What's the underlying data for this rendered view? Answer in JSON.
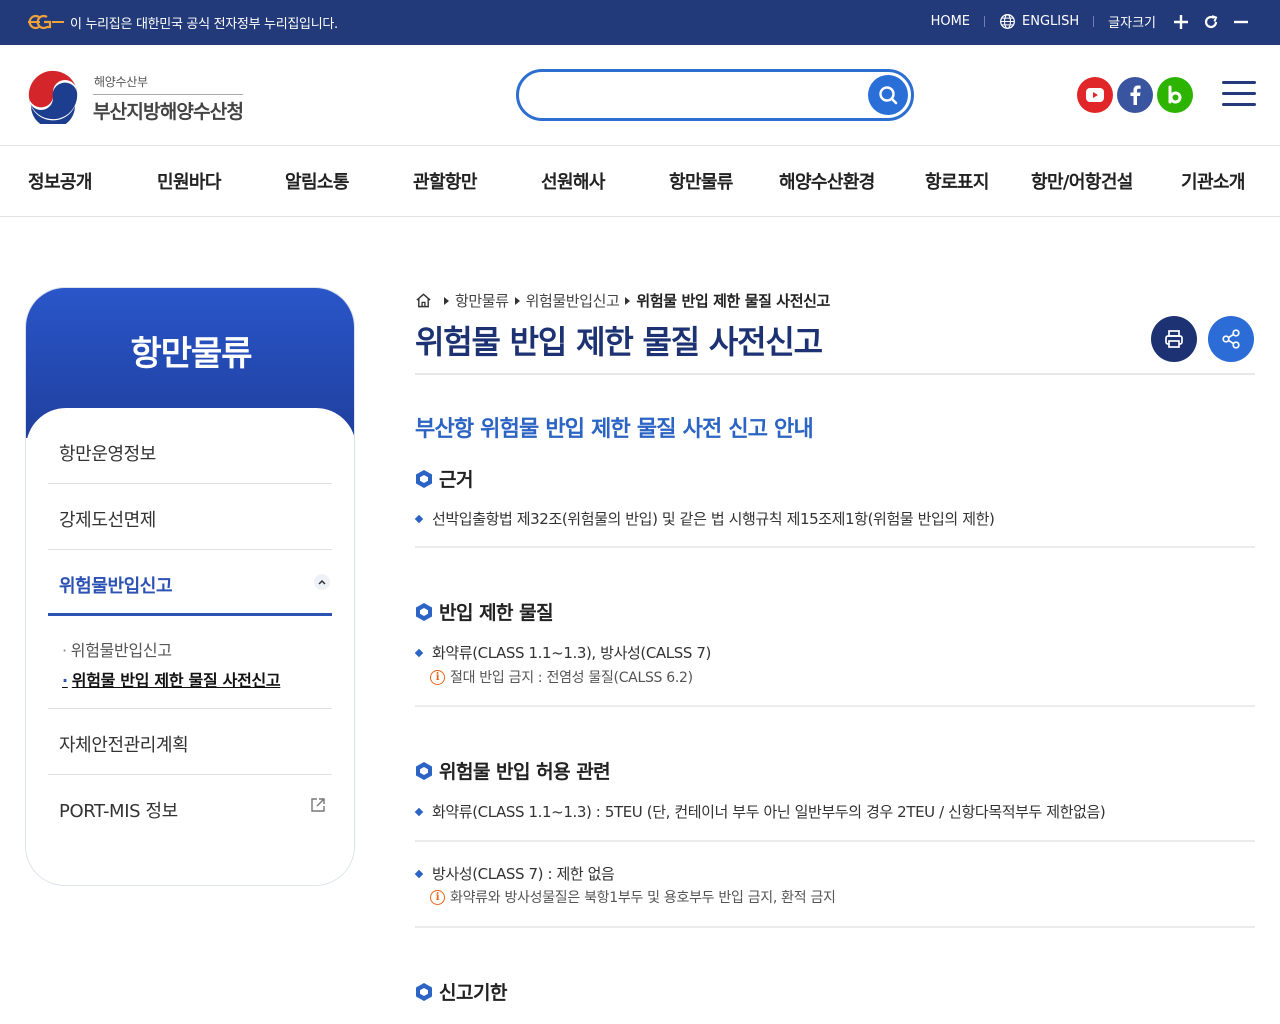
{
  "gov_bar": {
    "text": "이 누리집은 대한민국 공식 전자정부 누리집입니다.",
    "home": "HOME",
    "english": "ENGLISH",
    "font_size": "글자크기"
  },
  "header": {
    "org_sub": "해양수산부",
    "org_main": "부산지방해양수산청",
    "search_placeholder": "",
    "sns": [
      "youtube",
      "facebook",
      "blog"
    ]
  },
  "gnb": [
    "정보공개",
    "민원바다",
    "알림소통",
    "관할항만",
    "선원해사",
    "항만물류",
    "해양수산환경",
    "항로표지",
    "항만/어항건설",
    "기관소개"
  ],
  "side": {
    "title": "항만물류",
    "items": [
      "항만운영정보",
      "강제도선면제",
      "위험물반입신고",
      "자체안전관리계획",
      "PORT-MIS 정보"
    ],
    "sub_items": [
      "위험물반입신고",
      "위험물 반입 제한 물질 사전신고"
    ]
  },
  "breadcrumb": [
    "항만물류",
    "위험물반입신고",
    "위험물 반입 제한 물질 사전신고"
  ],
  "page_title": "위험물 반입 제한 물질 사전신고",
  "content": {
    "section_title": "부산항 위험물 반입 제한 물질 사전 신고 안내",
    "basis": {
      "heading": "근거",
      "text": "선박입출항법 제32조(위험물의 반입) 및 같은 법 시행규칙 제15조제1항(위험물 반입의 제한)"
    },
    "restricted": {
      "heading": "반입 제한 물질",
      "text": "화약류(CLASS 1.1~1.3), 방사성(CALSS 7)",
      "note": "절대 반입 금지 : 전염성 물질(CALSS 6.2)"
    },
    "allowance": {
      "heading": "위험물 반입 허용 관련",
      "text1": "화약류(CLASS 1.1~1.3) : 5TEU (단, 컨테이너 부두 아닌 일반부두의 경우 2TEU / 신항다목적부두 제한없음)",
      "text2": "방사성(CLASS 7) : 제한 없음",
      "note": "화약류와 방사성물질은 북항1부두 및 용호부두 반입 금지, 환적 금지"
    },
    "deadline": {
      "heading": "신고기한"
    }
  },
  "colors": {
    "gov_bar": "#233a7a",
    "primary": "#1d3272",
    "accent": "#2b64c4",
    "side_gradient_top": "#2a56c9",
    "warning": "#e8641a"
  }
}
